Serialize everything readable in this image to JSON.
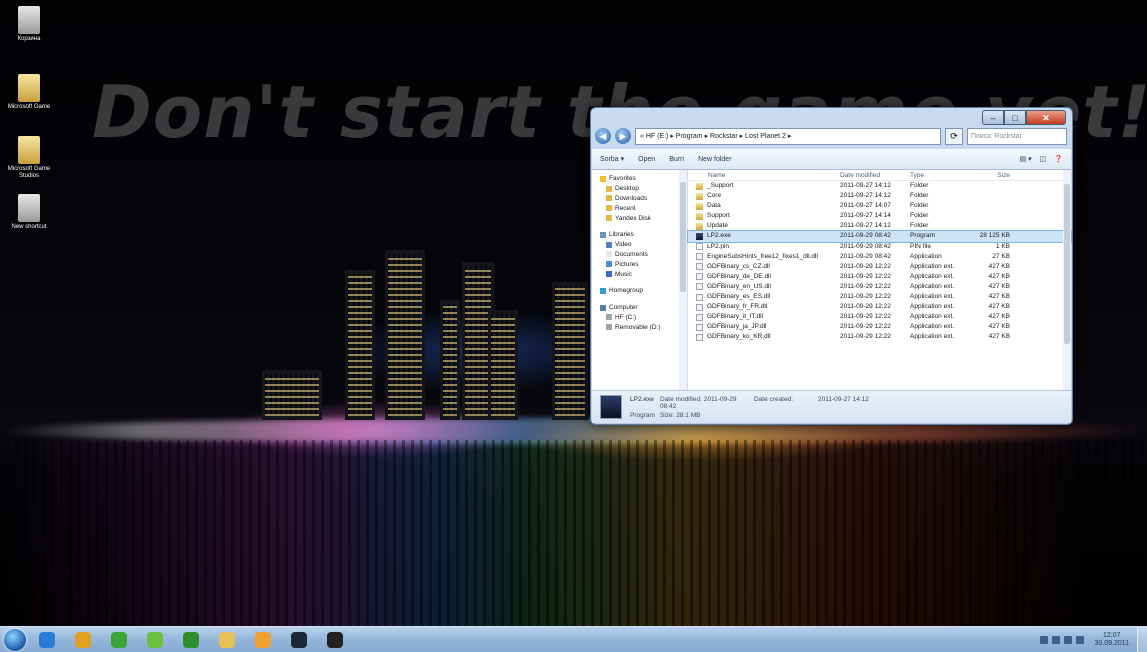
{
  "overlay_caption": "Don't start the game yet!",
  "desktop_icons": [
    {
      "label": "Корзина",
      "icon": "recycle-bin-icon"
    },
    {
      "label": "Microsoft Game",
      "icon": "folder-icon"
    },
    {
      "label": "Microsoft Game Studios",
      "icon": "folder-icon"
    },
    {
      "label": "New shortcut",
      "icon": "shortcut-icon"
    }
  ],
  "window": {
    "address_path": "« HF (E:) ▸ Program ▸ Rockstar ▸ Lost Planet 2 ▸",
    "search_placeholder": "Поиск: Rockstar",
    "toolbar": {
      "organize": "Sorba ▾",
      "open": "Open",
      "share": "Burn",
      "new_folder": "New folder",
      "views": "▤ ▾",
      "preview": "◫",
      "help": "❓"
    },
    "columns": {
      "name": "Name",
      "date": "Date modified",
      "type": "Type",
      "size": "Size"
    },
    "nav": [
      {
        "label": "Favorites",
        "kind": "header",
        "icon": "star-icon"
      },
      {
        "label": "Desktop",
        "kind": "sub",
        "icon": "folder-icon"
      },
      {
        "label": "Downloads",
        "kind": "sub",
        "icon": "folder-icon"
      },
      {
        "label": "Recent",
        "kind": "sub",
        "icon": "folder-icon"
      },
      {
        "label": "Yandex Disk",
        "kind": "sub",
        "icon": "folder-icon"
      },
      {
        "label": "",
        "kind": "gap"
      },
      {
        "label": "Libraries",
        "kind": "header",
        "icon": "library-icon"
      },
      {
        "label": "Video",
        "kind": "sub",
        "icon": "video-icon"
      },
      {
        "label": "Documents",
        "kind": "sub",
        "icon": "document-icon"
      },
      {
        "label": "Pictures",
        "kind": "sub",
        "icon": "picture-icon"
      },
      {
        "label": "Music",
        "kind": "sub",
        "icon": "music-icon"
      },
      {
        "label": "",
        "kind": "gap"
      },
      {
        "label": "Homegroup",
        "kind": "header",
        "icon": "homegroup-icon"
      },
      {
        "label": "",
        "kind": "gap"
      },
      {
        "label": "Computer",
        "kind": "header",
        "icon": "computer-icon"
      },
      {
        "label": "HF (C:)",
        "kind": "sub",
        "icon": "drive-icon"
      },
      {
        "label": "Removable (D:)",
        "kind": "sub",
        "icon": "drive-icon"
      }
    ],
    "files": [
      {
        "name": "_Support",
        "date": "2011-09-27 14:12",
        "type": "Folder",
        "size": "",
        "icon": "folder"
      },
      {
        "name": "Core",
        "date": "2011-09-27 14:12",
        "type": "Folder",
        "size": "",
        "icon": "folder"
      },
      {
        "name": "Data",
        "date": "2011-09-27 14:07",
        "type": "Folder",
        "size": "",
        "icon": "folder"
      },
      {
        "name": "Support",
        "date": "2011-09-27 14:14",
        "type": "Folder",
        "size": "",
        "icon": "folder"
      },
      {
        "name": "Update",
        "date": "2011-09-27 14:12",
        "type": "Folder",
        "size": "",
        "icon": "folder"
      },
      {
        "name": "LP2.exe",
        "date": "2011-09-29 08:42",
        "type": "Program",
        "size": "28 125 KB",
        "icon": "app",
        "selected": true
      },
      {
        "name": "LP2.pin",
        "date": "2011-09-29 08:42",
        "type": "PIN file",
        "size": "1 KB",
        "icon": "file"
      },
      {
        "name": "EngineSubsHints_free12_fixes1_dll.dll",
        "date": "2011-09-29 08:42",
        "type": "Application",
        "size": "27 KB",
        "icon": "dll"
      },
      {
        "name": "GDFBinary_cs_CZ.dll",
        "date": "2011-09-29 12:22",
        "type": "Application ext.",
        "size": "427 KB",
        "icon": "dll"
      },
      {
        "name": "GDFBinary_de_DE.dll",
        "date": "2011-09-29 12:22",
        "type": "Application ext.",
        "size": "427 KB",
        "icon": "dll"
      },
      {
        "name": "GDFBinary_en_US.dll",
        "date": "2011-09-29 12:22",
        "type": "Application ext.",
        "size": "427 KB",
        "icon": "dll"
      },
      {
        "name": "GDFBinary_es_ES.dll",
        "date": "2011-09-29 12:22",
        "type": "Application ext.",
        "size": "427 KB",
        "icon": "dll"
      },
      {
        "name": "GDFBinary_fr_FR.dll",
        "date": "2011-09-29 12:22",
        "type": "Application ext.",
        "size": "427 KB",
        "icon": "dll"
      },
      {
        "name": "GDFBinary_it_IT.dll",
        "date": "2011-09-29 12:22",
        "type": "Application ext.",
        "size": "427 KB",
        "icon": "dll"
      },
      {
        "name": "GDFBinary_ja_JP.dll",
        "date": "2011-09-29 12:22",
        "type": "Application ext.",
        "size": "427 KB",
        "icon": "dll"
      },
      {
        "name": "GDFBinary_ko_KR.dll",
        "date": "2011-09-29 12:22",
        "type": "Application ext.",
        "size": "427 KB",
        "icon": "dll"
      }
    ],
    "details": {
      "filename": "LP2.exe",
      "filetype": "Program",
      "modified_label": "Date modified:",
      "modified_value": "2011-09-29 08:42",
      "size_label": "Size:",
      "size_value": "28.1 MB",
      "created_label": "Date created:",
      "created_value": "2011-09-27 14:12"
    }
  },
  "taskbar": {
    "apps": [
      {
        "icon": "ie-icon",
        "color": "#2a7bd6"
      },
      {
        "icon": "chrome-icon",
        "color": "#e2a020"
      },
      {
        "icon": "media-icon",
        "color": "#3aa63a"
      },
      {
        "icon": "utorrent-icon",
        "color": "#6cbf3c"
      },
      {
        "icon": "xbox-icon",
        "color": "#2f8f2f"
      },
      {
        "icon": "explorer-icon",
        "color": "#e6c054"
      },
      {
        "icon": "settings-icon",
        "color": "#f0a030"
      },
      {
        "icon": "steam-icon",
        "color": "#1b2838"
      },
      {
        "icon": "game-icon",
        "color": "#222222"
      }
    ],
    "clock_time": "12:07",
    "clock_date": "30.09.2011"
  }
}
